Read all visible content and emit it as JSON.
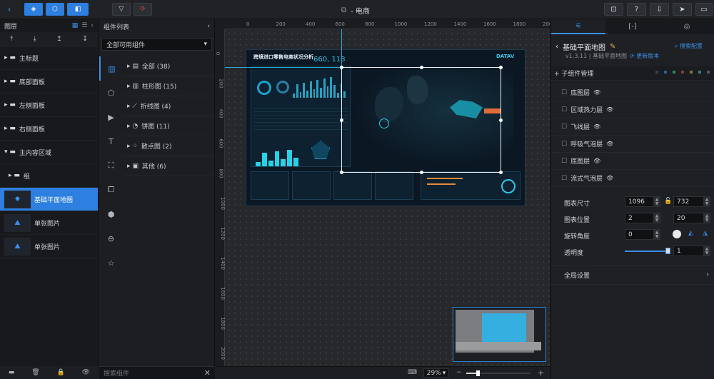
{
  "topbar": {
    "title": "- 电商",
    "back_icon": "chevron-left-icon"
  },
  "layers": {
    "title": "图层",
    "items": [
      {
        "label": "主标题",
        "type": "group"
      },
      {
        "label": "底部面板",
        "type": "group"
      },
      {
        "label": "左侧面板",
        "type": "group"
      },
      {
        "label": "右侧面板",
        "type": "group"
      },
      {
        "label": "主内容区域",
        "type": "group-open"
      },
      {
        "label": "组",
        "type": "subgroup"
      },
      {
        "label": "基础平面地图",
        "type": "map",
        "selected": true
      },
      {
        "label": "单张图片",
        "type": "image"
      },
      {
        "label": "单张图片",
        "type": "image"
      }
    ]
  },
  "components": {
    "title": "组件列表",
    "filter": "全部可用组件",
    "search_placeholder": "搜索组件",
    "items": [
      {
        "label": "全部 (38)",
        "icon": "grid-icon"
      },
      {
        "label": "柱形图 (15)",
        "icon": "bar-chart-icon"
      },
      {
        "label": "折线图 (4)",
        "icon": "line-chart-icon"
      },
      {
        "label": "饼图 (11)",
        "icon": "pie-chart-icon"
      },
      {
        "label": "散点图 (2)",
        "icon": "scatter-icon"
      },
      {
        "label": "其他 (6)",
        "icon": "other-icon"
      }
    ]
  },
  "canvas": {
    "ruler_h": [
      "0",
      "200",
      "400",
      "600",
      "800",
      "1000",
      "1200",
      "1400",
      "1600",
      "1800",
      "2000"
    ],
    "ruler_v": [
      "0",
      "200",
      "400",
      "600",
      "800",
      "1000",
      "1200",
      "1400",
      "1600",
      "1800",
      "2000"
    ],
    "dashboard_title": "跨境进口零售电商状况分析",
    "dashboard_logo": "DATAV",
    "coordinate": "660, 118",
    "zoom": "29%"
  },
  "props": {
    "component_name": "基础平面地图",
    "version": "v1.3.11 | 基础平面地图",
    "update_label": "更新版本",
    "search_config": "搜索配置",
    "subcomp_title": "+ 子组件管理",
    "subcomponents": [
      "底图层",
      "区域热力层",
      "飞线层",
      "呼吸气泡层",
      "底图层",
      "流式气泡层"
    ],
    "size_label": "图表尺寸",
    "size_w": "1096",
    "size_h": "732",
    "pos_label": "图表位置",
    "pos_x": "2",
    "pos_y": "20",
    "rotate_label": "旋转角度",
    "rotate_value": "0",
    "opacity_label": "透明度",
    "opacity_value": "1",
    "global_label": "全局设置"
  }
}
